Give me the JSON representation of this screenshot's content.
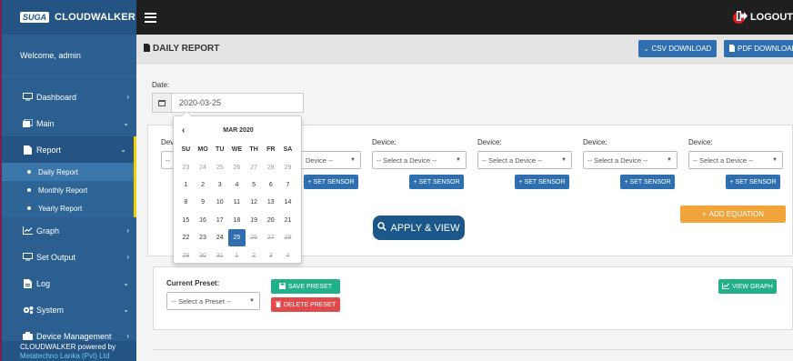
{
  "sidebar": {
    "brand_logo": "SUGA",
    "brand_name": "CLOUDWALKER",
    "welcome": "Welcome, admin",
    "items": [
      {
        "label": "Dashboard",
        "icon": "monitor-icon",
        "chevron": "›"
      },
      {
        "label": "Main",
        "icon": "folder-icon",
        "chevron": "⌄"
      },
      {
        "label": "Report",
        "icon": "document-icon",
        "chevron": "⌄"
      },
      {
        "label": "Graph",
        "icon": "chart-icon",
        "chevron": "›"
      },
      {
        "label": "Set Output",
        "icon": "monitor-icon",
        "chevron": "›"
      },
      {
        "label": "Log",
        "icon": "file-icon",
        "chevron": "⌄"
      },
      {
        "label": "System",
        "icon": "gears-icon",
        "chevron": "⌄"
      },
      {
        "label": "Device Management",
        "icon": "device-icon",
        "chevron": "›"
      }
    ],
    "report_sub": [
      "Daily Report",
      "Monthly Report",
      "Yearly Report"
    ],
    "footer_line1": "CLOUDWALKER powered by",
    "footer_line2": "Metatechno Lanka (Pvt) Ltd"
  },
  "topbar": {
    "logout": "LOGOUT"
  },
  "header": {
    "title": "DAILY REPORT",
    "csv_label": "CSV DOWNLOAD",
    "pdf_label": "PDF DOWNLOAD"
  },
  "date": {
    "label": "Date:",
    "value": "2020-03-25"
  },
  "devices": {
    "label": "Device:",
    "placeholder": "-- Select a Device --",
    "visible_partial": "Device --",
    "set_sensor": "SET SENSOR",
    "partial_label": "Dev",
    "partial_select": "--"
  },
  "apply_label": "APPLY & VIEW",
  "equation_label": "ADD EQUATION",
  "preset": {
    "label": "Current Preset:",
    "placeholder": "-- Select a Preset --",
    "save": "SAVE PRESET",
    "delete": "DELETE PRESET",
    "view_graph": "VIEW GRAPH"
  },
  "datepicker": {
    "prev": "‹",
    "month": "MAR 2020",
    "dow": [
      "SU",
      "MO",
      "TU",
      "WE",
      "TH",
      "FR",
      "SA"
    ],
    "weeks": [
      [
        "23",
        "24",
        "25",
        "26",
        "27",
        "28",
        "29"
      ],
      [
        "1",
        "2",
        "3",
        "4",
        "5",
        "6",
        "7"
      ],
      [
        "8",
        "9",
        "10",
        "11",
        "12",
        "13",
        "14"
      ],
      [
        "15",
        "16",
        "17",
        "18",
        "19",
        "20",
        "21"
      ],
      [
        "22",
        "23",
        "24",
        "25",
        "26",
        "27",
        "28"
      ],
      [
        "29",
        "30",
        "31",
        "1",
        "2",
        "3",
        "4"
      ]
    ],
    "selected": "25"
  }
}
